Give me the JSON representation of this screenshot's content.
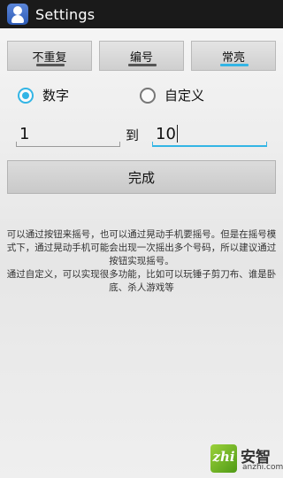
{
  "actionbar": {
    "title": "Settings",
    "icon": "app-person-icon"
  },
  "tabs": [
    {
      "label": "不重复",
      "active": false
    },
    {
      "label": "编号",
      "active": false
    },
    {
      "label": "常亮",
      "active": true
    }
  ],
  "mode": {
    "options": [
      {
        "label": "数字",
        "checked": true
      },
      {
        "label": "自定义",
        "checked": false
      }
    ]
  },
  "range": {
    "from": "1",
    "to_label": "到",
    "to": "10"
  },
  "done_button": {
    "label": "完成"
  },
  "help": {
    "lines": [
      "可以通过按钮来摇号，也可以通过晃动手机要摇号。但是在摇号模式下，通过晃动手机可能会出现一次摇出多个号码，所以建议通过按钮实现摇号。",
      "通过自定义，可以实现很多功能，比如可以玩锤子剪刀布、谁是卧底、杀人游戏等"
    ]
  },
  "watermark": {
    "chinese": "安智",
    "url": "anzhi.com",
    "badge": "zhi"
  },
  "colors": {
    "accent": "#33b5e5",
    "actionbar": "#1a1a1a"
  }
}
